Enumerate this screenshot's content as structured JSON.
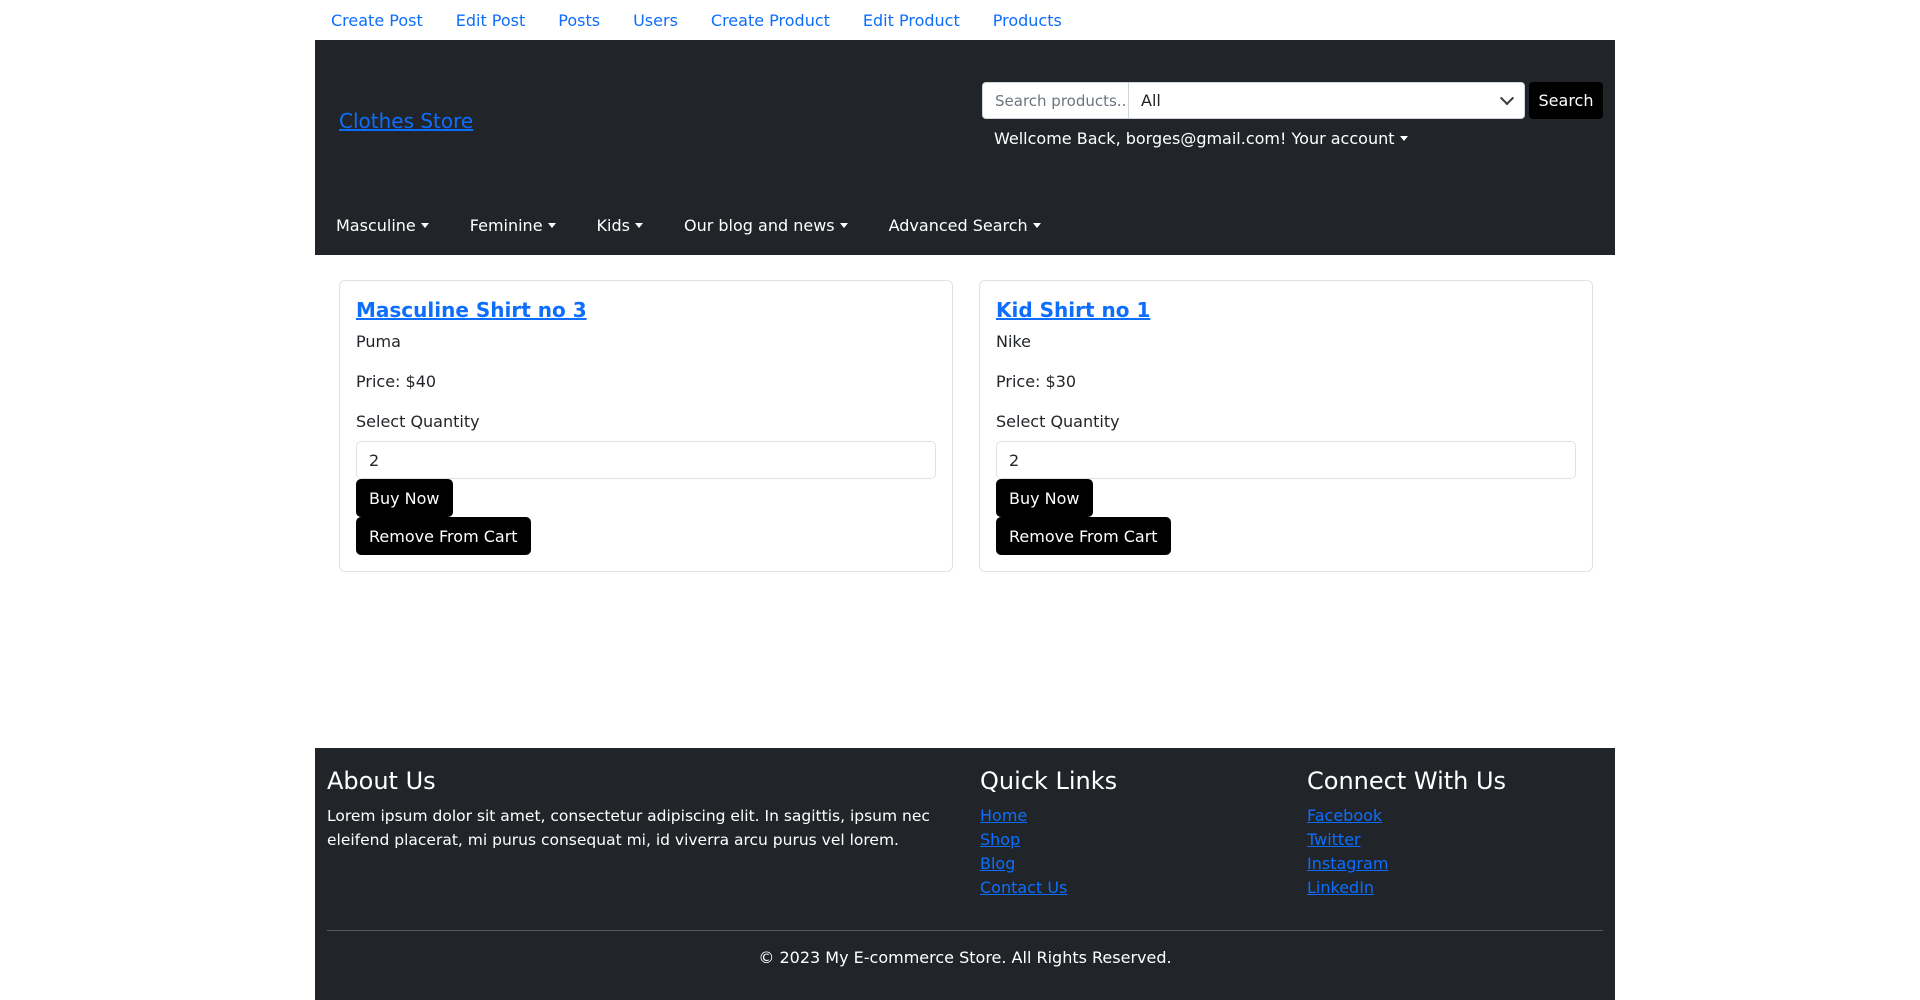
{
  "topnav": {
    "links": [
      "Create Post",
      "Edit Post",
      "Posts",
      "Users",
      "Create Product",
      "Edit Product",
      "Products"
    ]
  },
  "header": {
    "brand": "Clothes Store",
    "search": {
      "placeholder": "Search products...",
      "category_selected": "All",
      "button_label": "Search"
    },
    "welcome": "Wellcome Back, borges@gmail.com! Your account",
    "categories": [
      "Masculine",
      "Feminine",
      "Kids",
      "Our blog and news",
      "Advanced Search"
    ]
  },
  "cart": {
    "select_quantity_label": "Select Quantity",
    "buy_label": "Buy Now",
    "remove_label": "Remove From Cart",
    "items": [
      {
        "title": "Masculine Shirt no 3",
        "brand": "Puma",
        "price": "Price: $40",
        "quantity": "2"
      },
      {
        "title": "Kid Shirt no 1",
        "brand": "Nike",
        "price": "Price: $30",
        "quantity": "2"
      }
    ]
  },
  "footer": {
    "about": {
      "heading": "About Us",
      "text": "Lorem ipsum dolor sit amet, consectetur adipiscing elit. In sagittis, ipsum nec eleifend placerat, mi purus consequat mi, id viverra arcu purus vel lorem."
    },
    "quick_links": {
      "heading": "Quick Links",
      "links": [
        "Home",
        "Shop",
        "Blog",
        "Contact Us"
      ]
    },
    "connect": {
      "heading": "Connect With Us",
      "links": [
        "Facebook",
        "Twitter",
        "Instagram",
        "LinkedIn"
      ]
    },
    "copyright": "© 2023 My E-commerce Store. All Rights Reserved."
  }
}
